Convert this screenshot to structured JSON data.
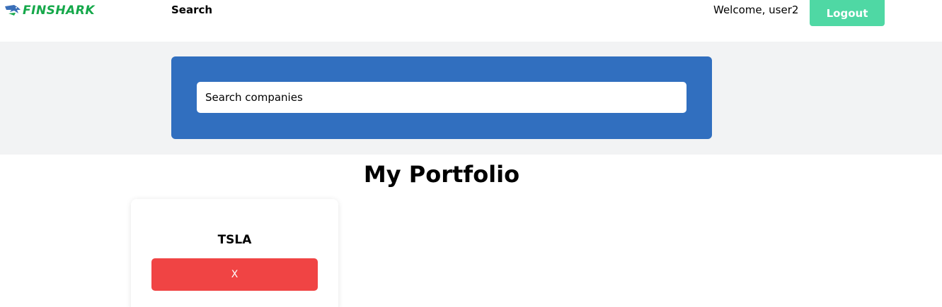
{
  "navbar": {
    "logo_text": "FINSHARK",
    "logo_icon": "shark-icon",
    "search_link": "Search",
    "welcome_text": "Welcome, user2",
    "logout_label": "Logout"
  },
  "search": {
    "placeholder": "Search companies",
    "value": ""
  },
  "portfolio": {
    "title": "My Portfolio",
    "items": [
      {
        "symbol": "TSLA",
        "remove_label": "X"
      }
    ]
  },
  "colors": {
    "brand_green": "#15a84a",
    "logout_bg": "#4fd8a4",
    "search_panel_bg": "#316fbf",
    "search_band_bg": "#f2f3f4",
    "remove_bg": "#f04444"
  }
}
